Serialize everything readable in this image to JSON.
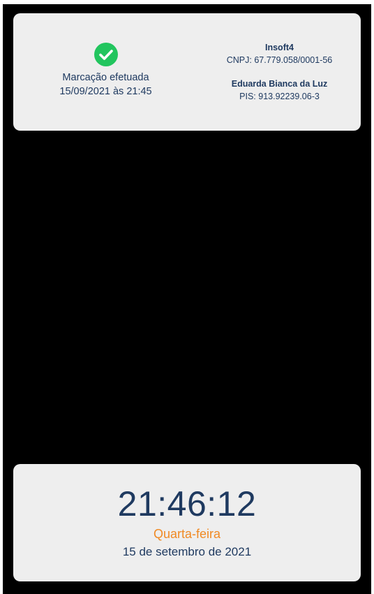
{
  "receipt": {
    "status_text": "Marcação efetuada",
    "timestamp": "15/09/2021 às 21:45",
    "status_icon": "check-circle-icon",
    "status_color": "#22c55e"
  },
  "company": {
    "name": "Insoft4",
    "cnpj": "CNPJ: 67.779.058/0001-56"
  },
  "employee": {
    "name": "Eduarda Bianca da Luz",
    "pis": "PIS: 913.92239.06-3"
  },
  "clock": {
    "time": "21:46:12",
    "weekday": "Quarta-feira",
    "date": "15 de setembro de 2021"
  },
  "colors": {
    "text_primary": "#1f3a60",
    "accent_orange": "#f08a24",
    "card_background": "#eeeeee",
    "screen_background": "#000000"
  }
}
